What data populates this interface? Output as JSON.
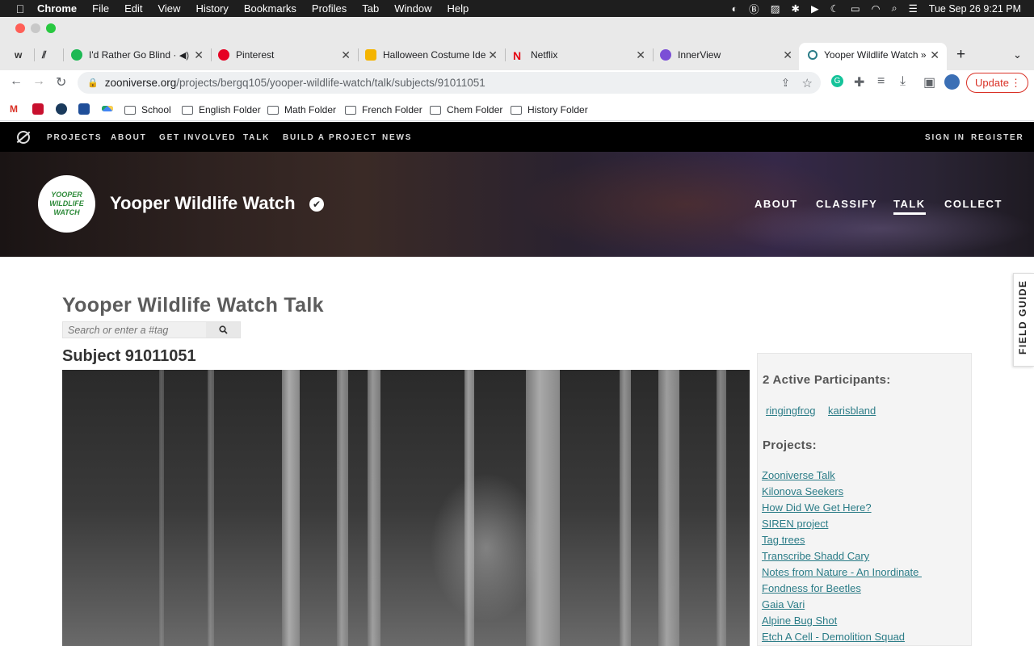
{
  "menubar": {
    "app": "Chrome",
    "items": [
      "File",
      "Edit",
      "View",
      "History",
      "Bookmarks",
      "Profiles",
      "Tab",
      "Window",
      "Help"
    ],
    "clock": "Tue Sep 26  9:21 PM"
  },
  "tabs": [
    {
      "title": "I'd Rather Go Blind · ",
      "color": "#1db954"
    },
    {
      "title": "Pinterest",
      "color": "#e60023"
    },
    {
      "title": "Halloween Costume Idea",
      "color": "#f4b400"
    },
    {
      "title": "Netflix",
      "color": "#e50914"
    },
    {
      "title": "InnerView",
      "color": "#7b4fd6"
    },
    {
      "title": "Yooper Wildlife Watch »",
      "color": "#2b7c87"
    }
  ],
  "address": {
    "host": "zooniverse.org",
    "path": "/projects/bergq105/yooper-wildlife-watch/talk/subjects/91011051"
  },
  "update_label": "Update",
  "bookmarks": [
    "School",
    "English Folder",
    "Math Folder",
    "French Folder",
    "Chem Folder",
    "History Folder"
  ],
  "zoonav": {
    "items": [
      "PROJECTS",
      "ABOUT",
      "GET INVOLVED",
      "TALK",
      "BUILD A PROJECT",
      "NEWS"
    ],
    "sign_in": "SIGN IN",
    "register": "REGISTER"
  },
  "project": {
    "title": "Yooper Wildlife Watch",
    "logo_lines": [
      "YOOPER",
      "WILDLIFE",
      "WATCH"
    ],
    "nav": [
      "ABOUT",
      "CLASSIFY",
      "TALK",
      "COLLECT"
    ]
  },
  "talk": {
    "title": "Yooper Wildlife Watch Talk",
    "search_placeholder": "Search or enter a #tag",
    "subject": "Subject 91011051"
  },
  "sidebar": {
    "participants_heading": "2 Active Participants:",
    "participants": [
      "ringingfrog",
      "karisbland"
    ],
    "projects_heading": "Projects:",
    "projects": [
      "Zooniverse Talk",
      "Kilonova Seekers",
      "How Did We Get Here?",
      "SIREN project",
      "Tag trees",
      "Transcribe Shadd Cary",
      "Notes from Nature - An Inordinate ",
      "Fondness for Beetles",
      "Gaia Vari",
      "Alpine Bug Shot",
      "Etch A Cell - Demolition Squad"
    ]
  },
  "field_guide": "FIELD GUIDE"
}
